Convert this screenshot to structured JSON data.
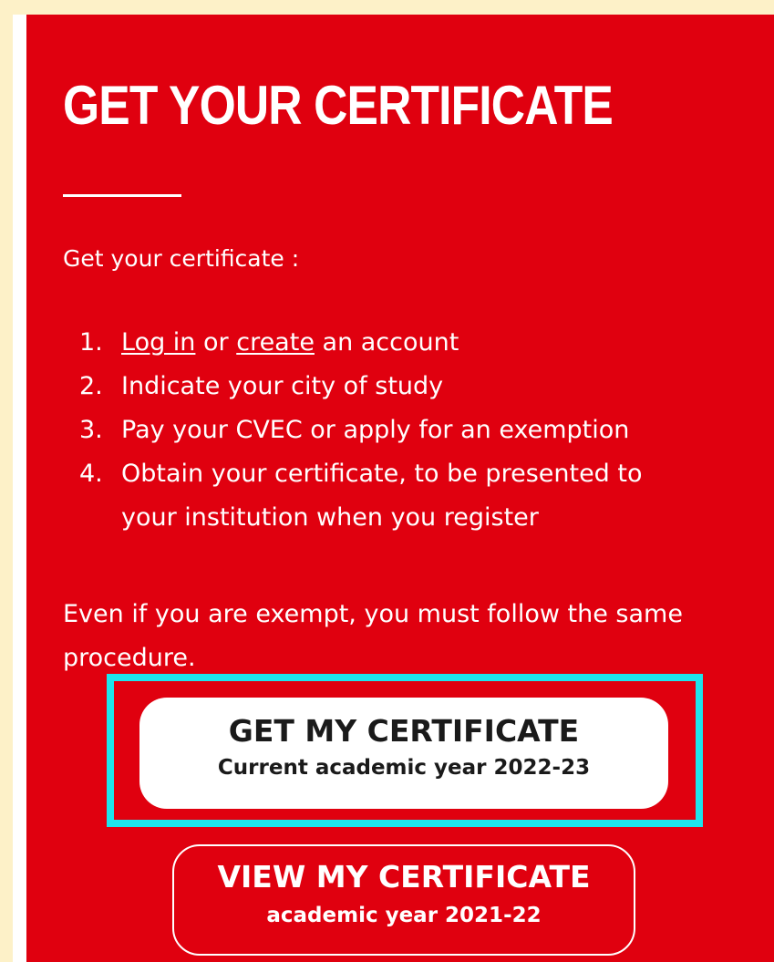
{
  "colors": {
    "page_background": "#fdf1c8",
    "panel_background": "#e0000f",
    "highlight_border": "#1ee4ec",
    "text_light": "#ffffff",
    "text_dark": "#1a1a1a"
  },
  "section": {
    "title": "GET YOUR CERTIFICATE",
    "intro": "Get your certificate :",
    "steps": [
      {
        "number": "1.",
        "login_link": "Log in",
        "or_text": " or ",
        "create_link": "create",
        "rest_text": " an account"
      },
      {
        "number": "2.",
        "text": "Indicate your city of study"
      },
      {
        "number": "3.",
        "text": "Pay your CVEC or apply for an exemption"
      },
      {
        "number": "4.",
        "line1": "Obtain your certificate, to be presented to",
        "line2": "your institution when you register"
      }
    ],
    "note": "Even if you are exempt, you must follow the same procedure."
  },
  "buttons": {
    "get_certificate": {
      "label": "GET MY CERTIFICATE",
      "sublabel": "Current academic year 2022-23"
    },
    "view_certificate": {
      "label": "VIEW MY CERTIFICATE",
      "sublabel": "academic year 2021-22"
    }
  }
}
